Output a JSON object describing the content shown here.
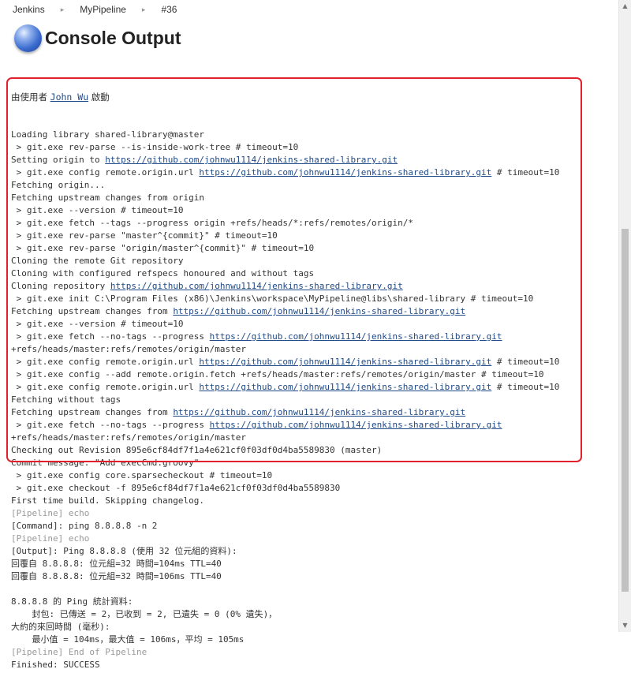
{
  "breadcrumb": {
    "items": [
      "Jenkins",
      "MyPipeline",
      "#36"
    ],
    "separator": "▸"
  },
  "header": {
    "title": "Console Output",
    "icon": "blue-ball-icon"
  },
  "console": {
    "started_prefix": "由使用者 ",
    "started_user": "John Wu",
    "started_suffix": " 啟動",
    "lines": [
      {
        "text": "Loading library shared-library@master"
      },
      {
        "text": " > git.exe rev-parse --is-inside-work-tree # timeout=10"
      },
      {
        "text": "Setting origin to ",
        "link": "https://github.com/johnwu1114/jenkins-shared-library.git"
      },
      {
        "text": " > git.exe config remote.origin.url ",
        "link": "https://github.com/johnwu1114/jenkins-shared-library.git",
        "after": " # timeout=10"
      },
      {
        "text": "Fetching origin..."
      },
      {
        "text": "Fetching upstream changes from origin"
      },
      {
        "text": " > git.exe --version # timeout=10"
      },
      {
        "text": " > git.exe fetch --tags --progress origin +refs/heads/*:refs/remotes/origin/*"
      },
      {
        "text": " > git.exe rev-parse \"master^{commit}\" # timeout=10"
      },
      {
        "text": " > git.exe rev-parse \"origin/master^{commit}\" # timeout=10"
      },
      {
        "text": "Cloning the remote Git repository"
      },
      {
        "text": "Cloning with configured refspecs honoured and without tags"
      },
      {
        "text": "Cloning repository ",
        "link": "https://github.com/johnwu1114/jenkins-shared-library.git"
      },
      {
        "text": " > git.exe init C:\\Program Files (x86)\\Jenkins\\workspace\\MyPipeline@libs\\shared-library # timeout=10"
      },
      {
        "text": "Fetching upstream changes from ",
        "link": "https://github.com/johnwu1114/jenkins-shared-library.git"
      },
      {
        "text": " > git.exe --version # timeout=10"
      },
      {
        "text": " > git.exe fetch --no-tags --progress ",
        "link": "https://github.com/johnwu1114/jenkins-shared-library.git"
      },
      {
        "text": "+refs/heads/master:refs/remotes/origin/master"
      },
      {
        "text": " > git.exe config remote.origin.url ",
        "link": "https://github.com/johnwu1114/jenkins-shared-library.git",
        "after": " # timeout=10"
      },
      {
        "text": " > git.exe config --add remote.origin.fetch +refs/heads/master:refs/remotes/origin/master # timeout=10"
      },
      {
        "text": " > git.exe config remote.origin.url ",
        "link": "https://github.com/johnwu1114/jenkins-shared-library.git",
        "after": " # timeout=10"
      },
      {
        "text": "Fetching without tags"
      },
      {
        "text": "Fetching upstream changes from ",
        "link": "https://github.com/johnwu1114/jenkins-shared-library.git"
      },
      {
        "text": " > git.exe fetch --no-tags --progress ",
        "link": "https://github.com/johnwu1114/jenkins-shared-library.git"
      },
      {
        "text": "+refs/heads/master:refs/remotes/origin/master"
      },
      {
        "text": "Checking out Revision 895e6cf84df7f1a4e621cf0f03df0d4ba5589830 (master)"
      },
      {
        "text": "Commit message: \"Add execCmd.groovy\""
      },
      {
        "text": " > git.exe config core.sparsecheckout # timeout=10"
      },
      {
        "text": " > git.exe checkout -f 895e6cf84df7f1a4e621cf0f03df0d4ba5589830"
      },
      {
        "text": "First time build. Skipping changelog."
      },
      {
        "text": "[Pipeline] echo",
        "style": "pipeline"
      },
      {
        "text": "[Command]: ping 8.8.8.8 -n 2"
      },
      {
        "text": "[Pipeline] echo",
        "style": "pipeline"
      },
      {
        "text": "[Output]: Ping 8.8.8.8 (使用 32 位元組的資料):"
      },
      {
        "text": "回覆自 8.8.8.8: 位元組=32 時間=104ms TTL=40"
      },
      {
        "text": "回覆自 8.8.8.8: 位元組=32 時間=106ms TTL=40"
      },
      {
        "text": ""
      },
      {
        "text": "8.8.8.8 的 Ping 統計資料:"
      },
      {
        "text": "    封包: 已傳送 = 2，已收到 = 2, 已遺失 = 0 (0% 遺失)，"
      },
      {
        "text": "大約的來回時間 (毫秒):"
      },
      {
        "text": "    最小值 = 104ms，最大值 = 106ms，平均 = 105ms"
      },
      {
        "text": "[Pipeline] End of Pipeline",
        "style": "pipeline"
      },
      {
        "text": "Finished: SUCCESS"
      }
    ]
  },
  "annotation": {
    "color": "#e0202a"
  }
}
